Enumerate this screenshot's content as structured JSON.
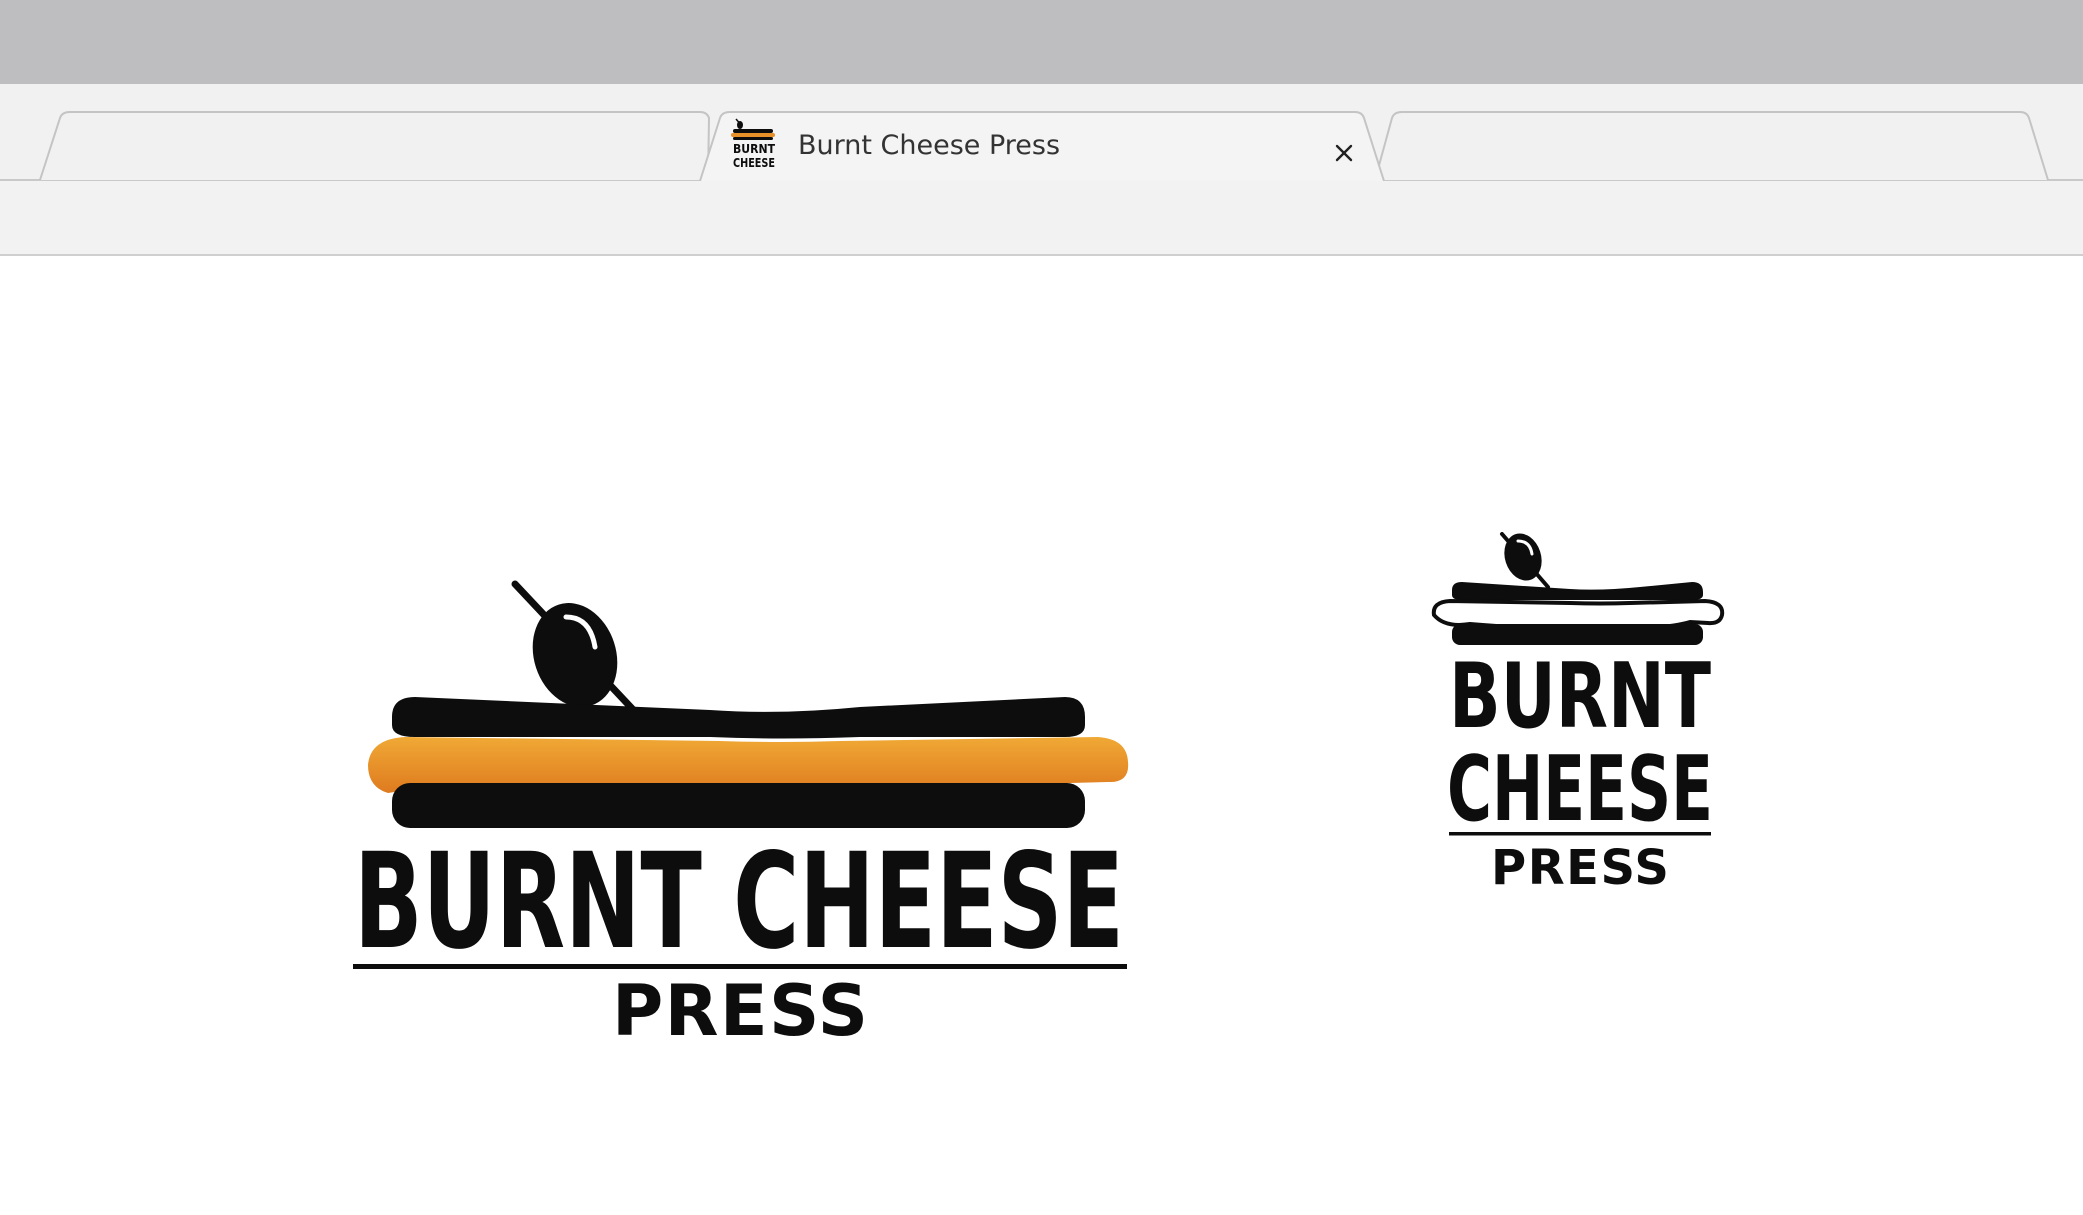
{
  "browser": {
    "tabs": [
      {
        "label": "",
        "active": false
      },
      {
        "label": "Burnt Cheese Press",
        "active": true
      },
      {
        "label": "",
        "active": false
      }
    ]
  },
  "page": {
    "logo_large": {
      "line1": "BURNT CHEESE",
      "line2": "PRESS"
    },
    "logo_small": {
      "line1": "BURNT",
      "line2": "CHEESE",
      "line3": "PRESS"
    },
    "favicon": {
      "line1": "BURNT",
      "line2": "CHEESE"
    }
  },
  "colors": {
    "ink": "#0c0d0c",
    "cheese_light": "#f0a935",
    "cheese_dark": "#de7a1f",
    "titlebar": "#bebec0",
    "tabstrip": "#f1f1f1"
  },
  "icons": [
    "olive-icon",
    "close-icon"
  ]
}
